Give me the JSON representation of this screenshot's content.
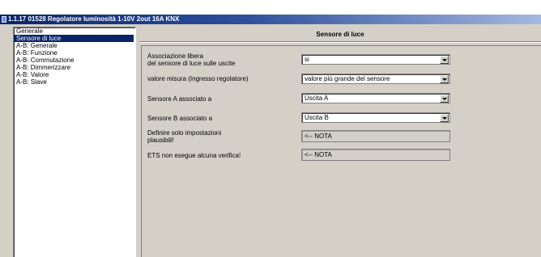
{
  "window": {
    "title": "1.1.17 01528 Regolatore luminosità 1-10V 2out 16A KNX"
  },
  "sidebar": {
    "items": [
      {
        "label": "Generale",
        "selected": false
      },
      {
        "label": "Sensore di luce",
        "selected": true
      },
      {
        "label": "A-B: Generale",
        "selected": false
      },
      {
        "label": "A-B: Funzione",
        "selected": false
      },
      {
        "label": "A-B: Commutazione",
        "selected": false
      },
      {
        "label": "A-B: Dimmerizzare",
        "selected": false
      },
      {
        "label": "A-B: Valore",
        "selected": false
      },
      {
        "label": "A-B: Slave",
        "selected": false
      }
    ]
  },
  "panel": {
    "header": "Sensore di luce",
    "rows": [
      {
        "label_lines": [
          "Associazione libera",
          "del sensore di luce sulle uscite"
        ],
        "type": "combo",
        "value": "si"
      },
      {
        "label_lines": [
          "valore misura (Ingresso regolatore)"
        ],
        "type": "combo",
        "value": "valore più grande del sensore"
      },
      {
        "label_lines": [
          "Sensore A associato a"
        ],
        "type": "combo",
        "value": "Uscita A"
      },
      {
        "label_lines": [
          "Sensore B associato a"
        ],
        "type": "combo",
        "value": "Uscita B"
      },
      {
        "label_lines": [
          "Definire solo impostazioni",
          "plausibili!"
        ],
        "type": "readonly",
        "value": "<-- NOTA"
      },
      {
        "label_lines": [
          "ETS non esegue alcuna verifica!"
        ],
        "type": "readonly",
        "value": "<-- NOTA"
      }
    ]
  },
  "colors": {
    "selection": "#0a246a",
    "window_face": "#d4d0c8"
  }
}
